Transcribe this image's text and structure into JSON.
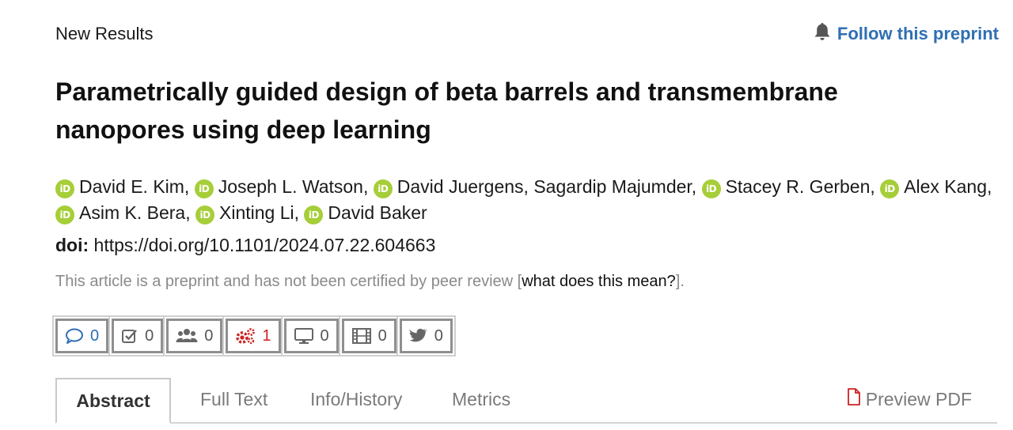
{
  "header": {
    "section_label": "New Results",
    "follow_label": "Follow this preprint",
    "follow_icon": "bell-icon"
  },
  "article": {
    "title": "Parametrically guided design of beta barrels and transmembrane nanopores using deep learning",
    "authors": [
      {
        "name": "David E. Kim,",
        "orcid": true
      },
      {
        "name": "Joseph L. Watson,",
        "orcid": true
      },
      {
        "name": "David Juergens,",
        "orcid": true
      },
      {
        "name": "Sagardip Majumder,",
        "orcid": false
      },
      {
        "name": "Stacey R. Gerben,",
        "orcid": true
      },
      {
        "name": "Alex Kang,",
        "orcid": true
      },
      {
        "name": "Asim K. Bera,",
        "orcid": true
      },
      {
        "name": "Xinting Li,",
        "orcid": true
      },
      {
        "name": "David Baker",
        "orcid": true
      }
    ],
    "orcid_badge_text": "iD",
    "doi_label": "doi:",
    "doi_url": "https://doi.org/10.1101/2024.07.22.604663",
    "preprint_note_before": "This article is a preprint and has not been certified by peer review [",
    "preprint_note_link": "what does this mean?",
    "preprint_note_after": "]."
  },
  "metrics": {
    "comments": "0",
    "reviews": "0",
    "community": "0",
    "automated": "1",
    "presentations": "0",
    "videos": "0",
    "tweets": "0"
  },
  "tabs": {
    "abstract": "Abstract",
    "full_text": "Full Text",
    "info_history": "Info/History",
    "metrics": "Metrics",
    "preview_pdf": "Preview PDF"
  },
  "colors": {
    "link_blue": "#2f6fb3",
    "orcid_green": "#a6ce39",
    "alert_red": "#cc2222",
    "note_gray": "#8a8a8a"
  }
}
